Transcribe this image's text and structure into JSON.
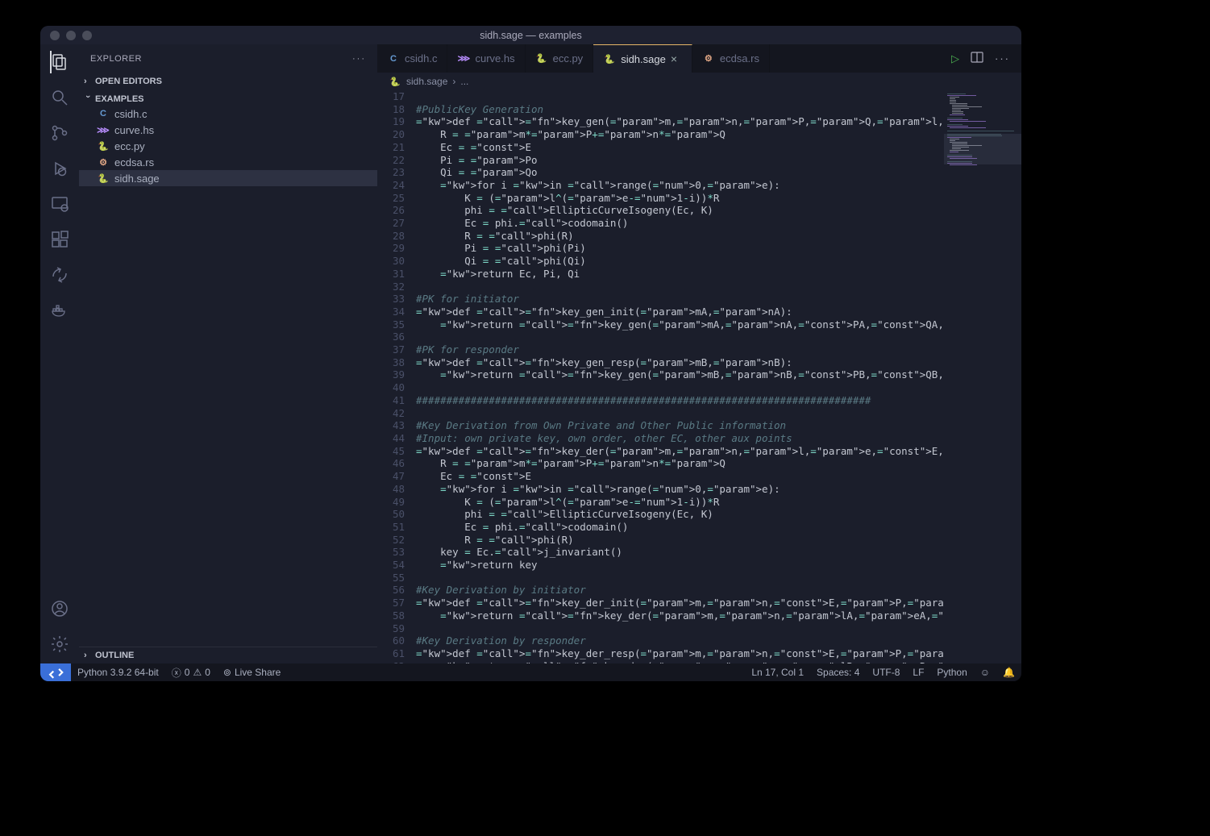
{
  "window": {
    "title": "sidh.sage — examples"
  },
  "sidebar": {
    "header": "EXPLORER",
    "sections": {
      "open_editors": "OPEN EDITORS",
      "folder": "EXAMPLES",
      "outline": "OUTLINE"
    },
    "files": [
      {
        "name": "csidh.c",
        "icon": "C",
        "color": "#659ad2"
      },
      {
        "name": "curve.hs",
        "icon": "⋙",
        "color": "#b98eff"
      },
      {
        "name": "ecc.py",
        "icon": "🐍",
        "color": "#64b5f6"
      },
      {
        "name": "ecdsa.rs",
        "icon": "⚙",
        "color": "#dea584"
      },
      {
        "name": "sidh.sage",
        "icon": "🐍",
        "color": "#64b5f6",
        "active": true
      }
    ]
  },
  "tabs": [
    {
      "name": "csidh.c",
      "icon": "C",
      "color": "#659ad2"
    },
    {
      "name": "curve.hs",
      "icon": "⋙",
      "color": "#b98eff"
    },
    {
      "name": "ecc.py",
      "icon": "🐍",
      "color": "#64b5f6"
    },
    {
      "name": "sidh.sage",
      "icon": "🐍",
      "color": "#64b5f6",
      "active": true
    },
    {
      "name": "ecdsa.rs",
      "icon": "⚙",
      "color": "#dea584"
    }
  ],
  "breadcrumb": {
    "file": "sidh.sage",
    "icon": "🐍",
    "more": "..."
  },
  "editor": {
    "first_line": 17,
    "lines": [
      "",
      "#PublicKey Generation",
      "def key_gen(m,n,P,Q,l,e,Po,Qo,E):",
      "    R = m*P+n*Q",
      "    Ec = E",
      "    Pi = Po",
      "    Qi = Qo",
      "    for i in range(0,e):",
      "        K = (l^(e-1-i))*R",
      "        phi = EllipticCurveIsogeny(Ec, K)",
      "        Ec = phi.codomain()",
      "        R = phi(R)",
      "        Pi = phi(Pi)",
      "        Qi = phi(Qi)",
      "    return Ec, Pi, Qi",
      "",
      "#PK for initiator",
      "def key_gen_init(mA,nA):",
      "    return key_gen(mA,nA,PA,QA,lA,eA,PB,QB,E)",
      "",
      "#PK for responder",
      "def key_gen_resp(mB,nB):",
      "    return key_gen(mB,nB,PB,QB,lB,eB,PA,QA,E)",
      "",
      "###########################################################################",
      "",
      "#Key Derivation from Own Private and Other Public information",
      "#Input: own private key, own order, other EC, other aux points",
      "def key_der(m,n,l,e,E,P,Q):",
      "    R = m*P+n*Q",
      "    Ec = E",
      "    for i in range(0,e):",
      "        K = (l^(e-1-i))*R",
      "        phi = EllipticCurveIsogeny(Ec, K)",
      "        Ec = phi.codomain()",
      "        R = phi(R)",
      "    key = Ec.j_invariant()",
      "    return key",
      "",
      "#Key Derivation by initiator",
      "def key_der_init(m,n,E,P,Q):",
      "    return key_der(m,n,lA,eA,E,P,Q)",
      "",
      "#Key Derivation by responder",
      "def key_der_resp(m,n,E,P,Q):",
      "    return key_der(m,n,lB,eB,E,P,Q)"
    ]
  },
  "status": {
    "interpreter": "Python 3.9.2 64-bit",
    "errors": "0",
    "warnings": "0",
    "liveshare": "Live Share",
    "cursor": "Ln 17, Col 1",
    "spaces": "Spaces: 4",
    "encoding": "UTF-8",
    "eol": "LF",
    "lang": "Python"
  }
}
